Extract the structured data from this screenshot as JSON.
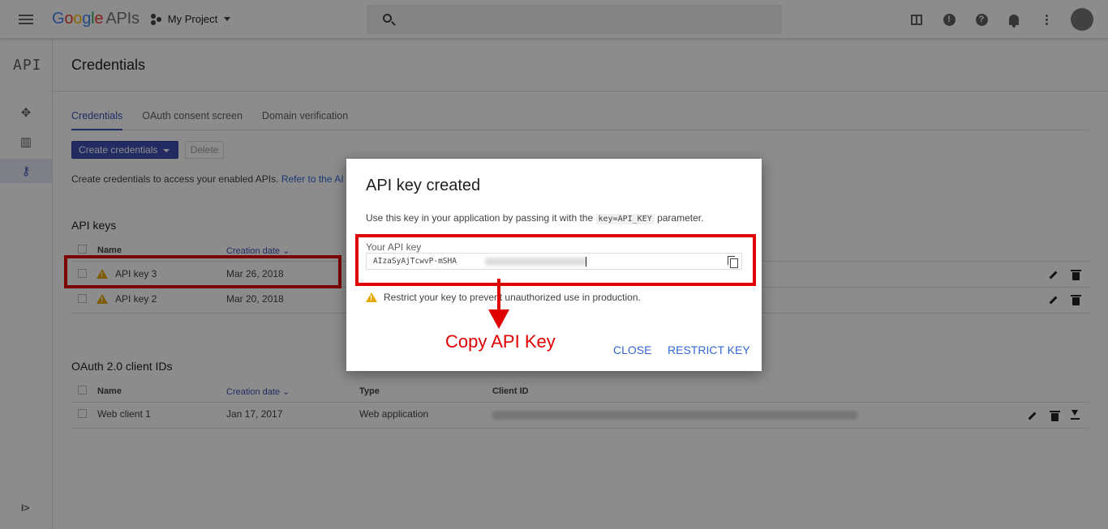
{
  "topbar": {
    "logo_letters": [
      "G",
      "o",
      "o",
      "g",
      "l",
      "e"
    ],
    "logo_suffix": "APIs",
    "project_name": "My Project"
  },
  "rail": {
    "logo_text": "API",
    "expand_glyph": "I>"
  },
  "page": {
    "title": "Credentials",
    "tabs": [
      "Credentials",
      "OAuth consent screen",
      "Domain verification"
    ],
    "create_label": "Create credentials",
    "delete_label": "Delete",
    "hint_text": "Create credentials to access your enabled APIs.",
    "hint_link": "Refer to the AI"
  },
  "api_keys": {
    "heading": "API keys",
    "col_name": "Name",
    "col_date": "Creation date",
    "rows": [
      {
        "name": "API key 3",
        "date": "Mar 26, 2018"
      },
      {
        "name": "API key 2",
        "date": "Mar 20, 2018"
      }
    ]
  },
  "oauth": {
    "heading": "OAuth 2.0 client IDs",
    "col_name": "Name",
    "col_date": "Creation date",
    "col_type": "Type",
    "col_client": "Client ID",
    "rows": [
      {
        "name": "Web client 1",
        "date": "Jan 17, 2017",
        "type": "Web application"
      }
    ]
  },
  "dialog": {
    "title": "API key created",
    "text_before": "Use this key in your application by passing it with the",
    "code": "key=API_KEY",
    "text_after": "parameter.",
    "key_label": "Your API key",
    "key_value": "AIzaSyAjTcwvP-mSHA",
    "warning": "Restrict your key to prevent unauthorized use in production.",
    "close_label": "CLOSE",
    "restrict_label": "RESTRICT KEY"
  },
  "annotation": {
    "text": "Copy API Key",
    "color": "#e00000"
  },
  "colors": {
    "accent": "#3f51b5",
    "link": "#3367d6",
    "warning": "#e6a700"
  }
}
